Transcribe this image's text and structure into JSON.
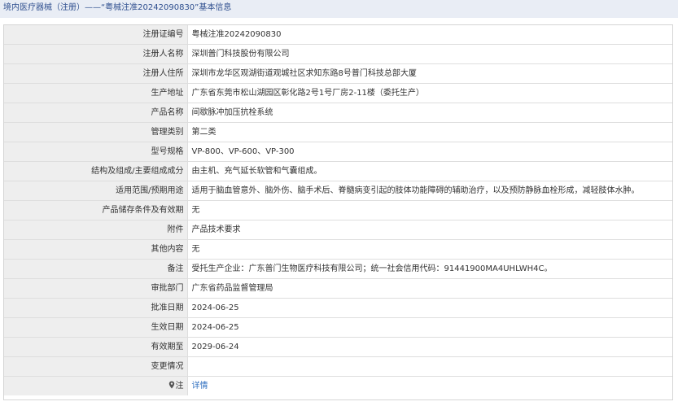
{
  "header": {
    "title": "境内医疗器械（注册）——“粤械注准20242090830”基本信息"
  },
  "rows": [
    {
      "label": "注册证编号",
      "value": "粤械注准20242090830"
    },
    {
      "label": "注册人名称",
      "value": "深圳普门科技股份有限公司"
    },
    {
      "label": "注册人住所",
      "value": "深圳市龙华区观湖街道观城社区求知东路8号普门科技总部大厦"
    },
    {
      "label": "生产地址",
      "value": "广东省东莞市松山湖园区彰化路2号1号厂房2-11楼（委托生产）"
    },
    {
      "label": "产品名称",
      "value": "间歇脉冲加压抗栓系统"
    },
    {
      "label": "管理类别",
      "value": "第二类"
    },
    {
      "label": "型号规格",
      "value": "VP-800、VP-600、VP-300"
    },
    {
      "label": "结构及组成/主要组成成分",
      "value": "由主机、充气延长软管和气囊组成。"
    },
    {
      "label": "适用范围/预期用途",
      "value": "适用于脑血管意外、脑外伤、脑手术后、脊髓病变引起的肢体功能障碍的辅助治疗，以及预防静脉血栓形成，减轻肢体水肿。"
    },
    {
      "label": "产品储存条件及有效期",
      "value": "无"
    },
    {
      "label": "附件",
      "value": "产品技术要求"
    },
    {
      "label": "其他内容",
      "value": "无"
    },
    {
      "label": "备注",
      "value": "受托生产企业：广东普门生物医疗科技有限公司；统一社会信用代码：91441900MA4UHLWH4C。"
    },
    {
      "label": "审批部门",
      "value": "广东省药品监督管理局"
    },
    {
      "label": "批准日期",
      "value": "2024-06-25"
    },
    {
      "label": "生效日期",
      "value": "2024-06-25"
    },
    {
      "label": "有效期至",
      "value": "2029-06-24"
    },
    {
      "label": "变更情况",
      "value": ""
    }
  ],
  "note": {
    "label": "注",
    "link": "详情",
    "icon": "map-pin-icon"
  }
}
